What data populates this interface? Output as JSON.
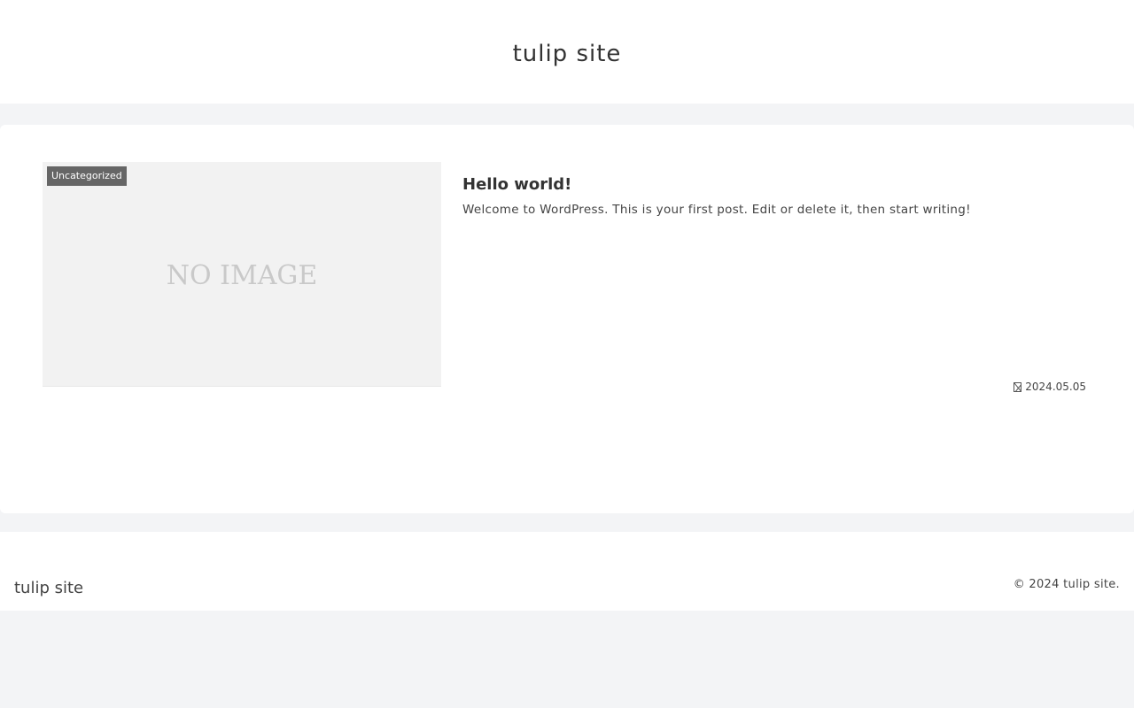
{
  "header": {
    "site_title": "tulip site"
  },
  "post": {
    "category": "Uncategorized",
    "thumbnail_placeholder": "NO IMAGE",
    "title": "Hello world!",
    "excerpt": "Welcome to WordPress. This is your first post. Edit or delete it, then start writing!",
    "date_icon": "calendar-icon",
    "date": "2024.05.05"
  },
  "footer": {
    "site_title": "tulip site",
    "copyright": "© 2024 tulip site."
  },
  "colors": {
    "page_background": "#f3f4f6",
    "card_background": "#ffffff",
    "category_badge": "#666666",
    "thumbnail_background": "#f2f2f2",
    "text": "#333333"
  }
}
